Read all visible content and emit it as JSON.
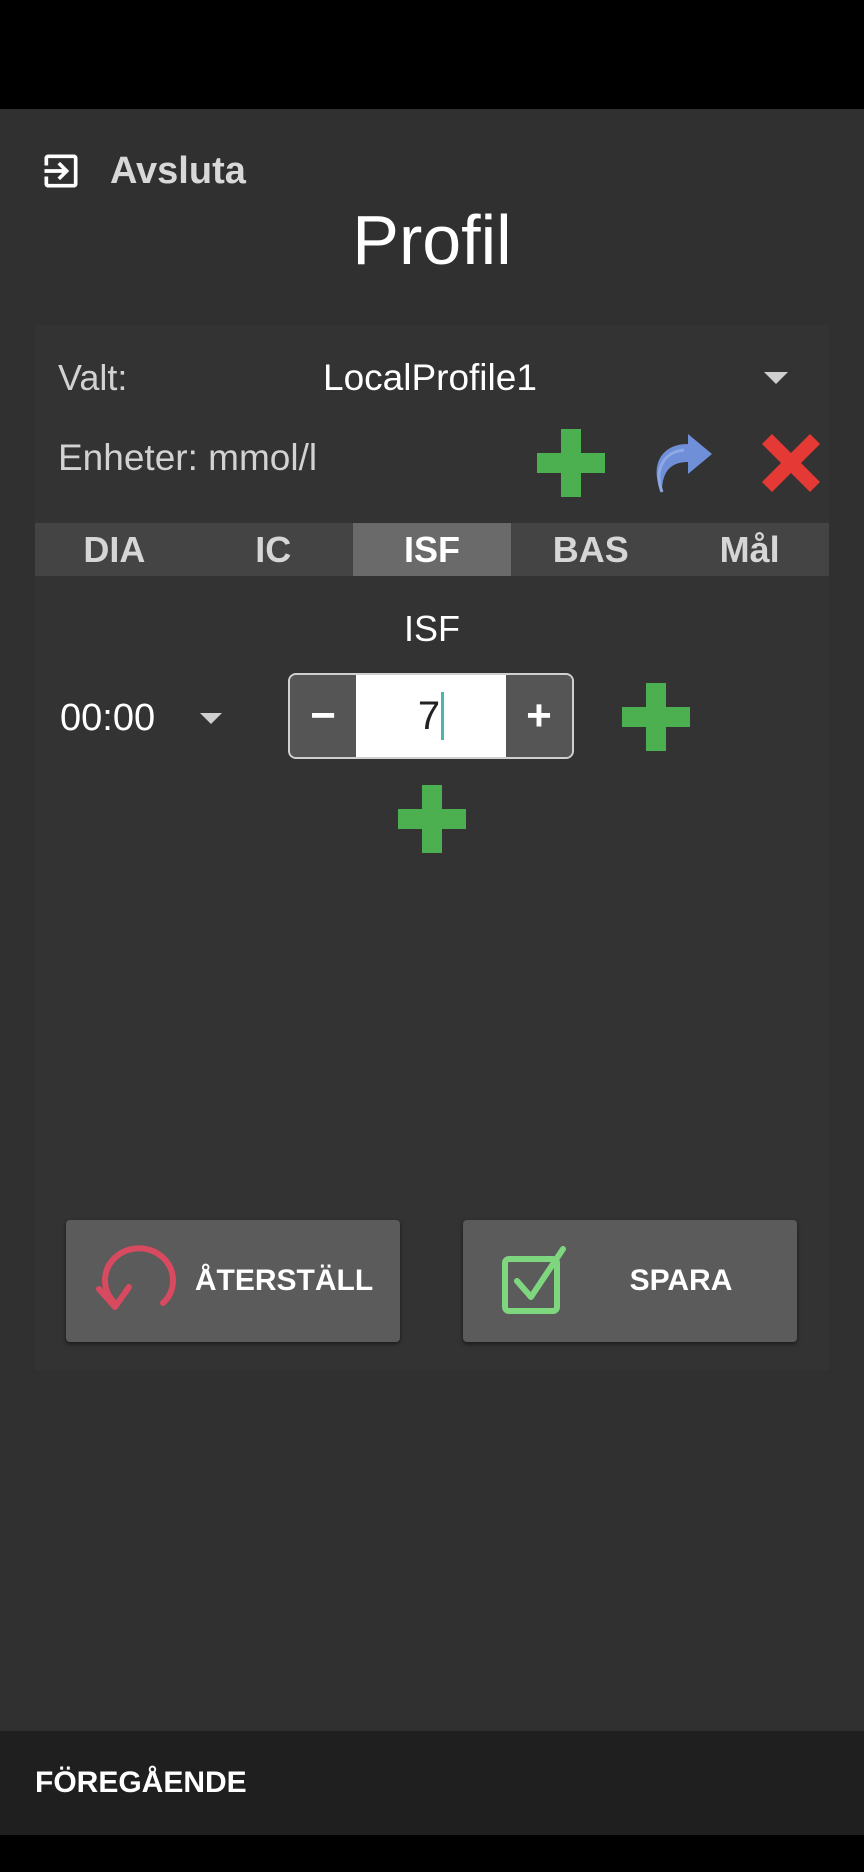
{
  "header": {
    "exit_label": "Avsluta",
    "title": "Profil"
  },
  "profile": {
    "selected_label": "Valt:",
    "selected_value": "LocalProfile1",
    "units_label": "Enheter: mmol/l"
  },
  "tabs": [
    {
      "label": "DIA",
      "active": false
    },
    {
      "label": "IC",
      "active": false
    },
    {
      "label": "ISF",
      "active": true
    },
    {
      "label": "BAS",
      "active": false
    },
    {
      "label": "Mål",
      "active": false
    }
  ],
  "isf": {
    "section_title": "ISF",
    "entries": [
      {
        "time": "00:00",
        "value": "7"
      }
    ],
    "minus_label": "−",
    "plus_label": "+"
  },
  "buttons": {
    "reset_label": "ÅTERSTÄLL",
    "save_label": "SPARA"
  },
  "footer": {
    "previous_label": "FÖREGÅENDE"
  },
  "colors": {
    "add_green": "#4caf50",
    "delete_red": "#e53935",
    "clone_blue": "#6f8fd8",
    "reset_red": "#d84a5f",
    "save_green": "#7ed77e",
    "cursor_teal": "#4db6ac"
  }
}
